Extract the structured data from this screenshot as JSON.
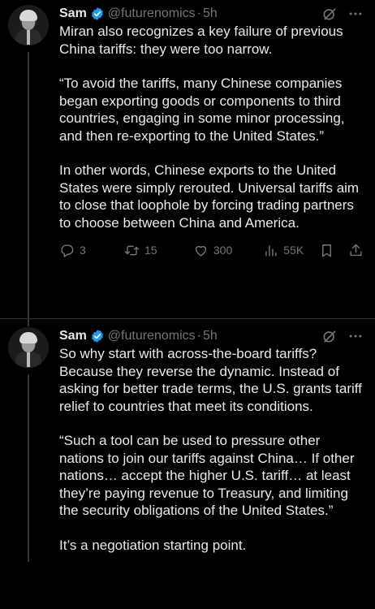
{
  "tweets": [
    {
      "author": {
        "name": "Sam",
        "handle": "@futurenomics",
        "time": "5h",
        "verified": true
      },
      "paragraphs": [
        "Miran also recognizes a key failure of previous China tariffs: they were too narrow.",
        "“To avoid the tariffs, many Chinese companies began exporting goods or components to third countries, engaging in some minor processing, and then re-exporting to the United States.”",
        "In other words, Chinese exports to the United States were simply rerouted. Universal tariffs aim to close that loophole by forcing trading partners to choose between China and America."
      ],
      "metrics": {
        "replies": "3",
        "retweets": "15",
        "likes": "300",
        "views": "55K"
      }
    },
    {
      "author": {
        "name": "Sam",
        "handle": "@futurenomics",
        "time": "5h",
        "verified": true
      },
      "paragraphs": [
        "So why start with across-the-board tariffs? Because they reverse the dynamic. Instead of asking for better trade terms, the U.S. grants tariff relief to countries that meet its conditions.",
        "“Such a tool can be used to pressure other nations to join our tariffs against China… If other nations… accept the higher U.S. tariff… at least they’re paying revenue to Treasury, and limiting the security obligations of the United States.”",
        "It’s a negotiation starting point."
      ]
    }
  ],
  "separator": "·",
  "icons": {
    "verified": "verified-badge-icon",
    "grok": "grok-icon",
    "more": "more-icon",
    "reply": "reply-icon",
    "retweet": "retweet-icon",
    "like": "heart-icon",
    "views": "views-icon",
    "bookmark": "bookmark-icon",
    "share": "share-icon"
  },
  "colors": {
    "background": "#000000",
    "text": "#e7e9ea",
    "secondary": "#71767b",
    "verified": "#1d9bf0",
    "divider": "#2f3336"
  }
}
